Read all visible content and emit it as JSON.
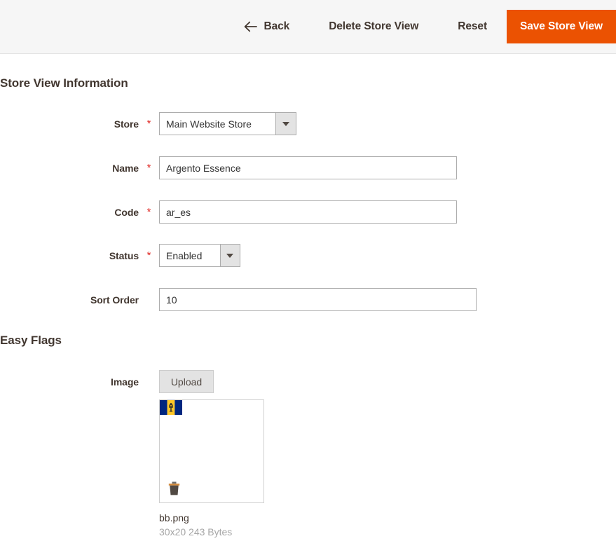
{
  "header": {
    "back_label": "Back",
    "delete_label": "Delete Store View",
    "reset_label": "Reset",
    "save_label": "Save Store View",
    "back_icon": "arrow-left-icon",
    "save_button_color": "#eb5202",
    "background_color": "#f6f6f6"
  },
  "sections": {
    "store_view_information": {
      "title": "Store View Information",
      "fields": {
        "store": {
          "label": "Store",
          "required_marker": "*",
          "value": "Main Website Store",
          "type": "select"
        },
        "name": {
          "label": "Name",
          "required_marker": "*",
          "value": "Argento Essence",
          "placeholder": "",
          "type": "text"
        },
        "code": {
          "label": "Code",
          "required_marker": "*",
          "value": "ar_es",
          "placeholder": "",
          "type": "text"
        },
        "status": {
          "label": "Status",
          "required_marker": "*",
          "value": "Enabled",
          "type": "select"
        },
        "sort_order": {
          "label": "Sort Order",
          "required_marker": "",
          "value": "10",
          "placeholder": "",
          "type": "text"
        }
      }
    },
    "easy_flags": {
      "title": "Easy Flags",
      "fields": {
        "image": {
          "label": "Image",
          "required_marker": "",
          "upload_label": "Upload",
          "preview": {
            "image_alt": "barbados-flag-image",
            "delete_icon": "trash-icon",
            "file_name": "bb.png",
            "file_meta": "30x20 243 Bytes"
          }
        }
      }
    }
  },
  "colors": {
    "required_star": "#e02b27",
    "label_text": "#41362f",
    "input_border": "#adadad",
    "flag_blue": "#00267f",
    "flag_yellow": "#ffc726"
  }
}
